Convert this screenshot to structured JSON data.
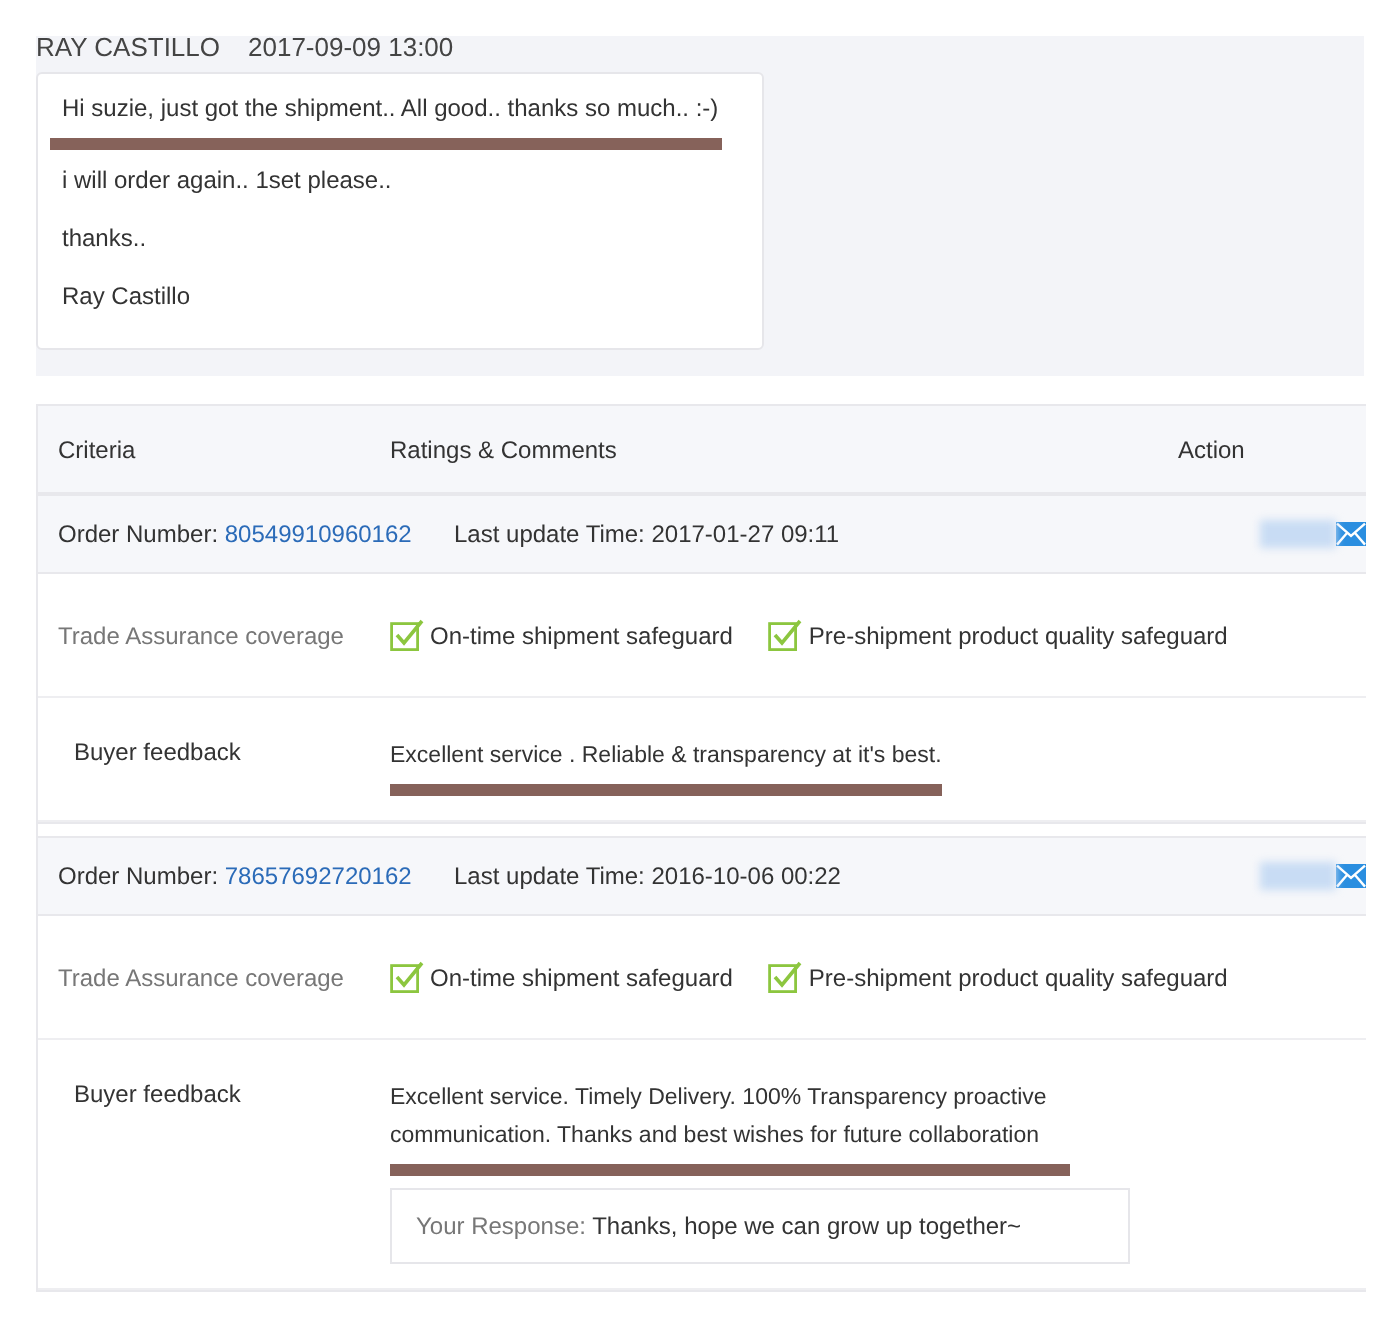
{
  "message": {
    "sender": "RAY CASTILLO",
    "time": "2017-09-09 13:00",
    "lines": [
      {
        "text": "Hi suzie, just got the shipment.. All good.. thanks so much.. :-)",
        "underlined": true
      },
      {
        "text": "i will order again.. 1set please..",
        "underlined": false
      },
      {
        "text": "thanks..",
        "underlined": false
      },
      {
        "text": "Ray Castillo",
        "underlined": false
      }
    ]
  },
  "table": {
    "columns": [
      "Criteria",
      "Ratings & Comments",
      "Action"
    ],
    "orders": [
      {
        "order_label": "Order Number:",
        "order_number": "80549910960162",
        "update_label": "Last update Time:",
        "update_time": "2017-01-27 09:11",
        "coverage_label": "Trade Assurance coverage",
        "safeguards": [
          {
            "label": "On-time shipment safeguard",
            "checked": true
          },
          {
            "label": "Pre-shipment product quality safeguard",
            "checked": true
          }
        ],
        "feedback_label": "Buyer feedback",
        "feedback": "Excellent service . Reliable & transparency at it's best.",
        "underlined": true
      },
      {
        "order_label": "Order Number:",
        "order_number": "78657692720162",
        "update_label": "Last update Time:",
        "update_time": "2016-10-06 00:22",
        "coverage_label": "Trade Assurance coverage",
        "safeguards": [
          {
            "label": "On-time shipment safeguard",
            "checked": true
          },
          {
            "label": "Pre-shipment product quality safeguard",
            "checked": true
          }
        ],
        "feedback_label": "Buyer feedback",
        "feedback": "Excellent service. Timely Delivery. 100% Transparency proactive communication. Thanks and best wishes for future collaboration",
        "underlined": true,
        "response_label": "Your Response:",
        "response": "Thanks, hope we can grow up together~"
      }
    ]
  }
}
